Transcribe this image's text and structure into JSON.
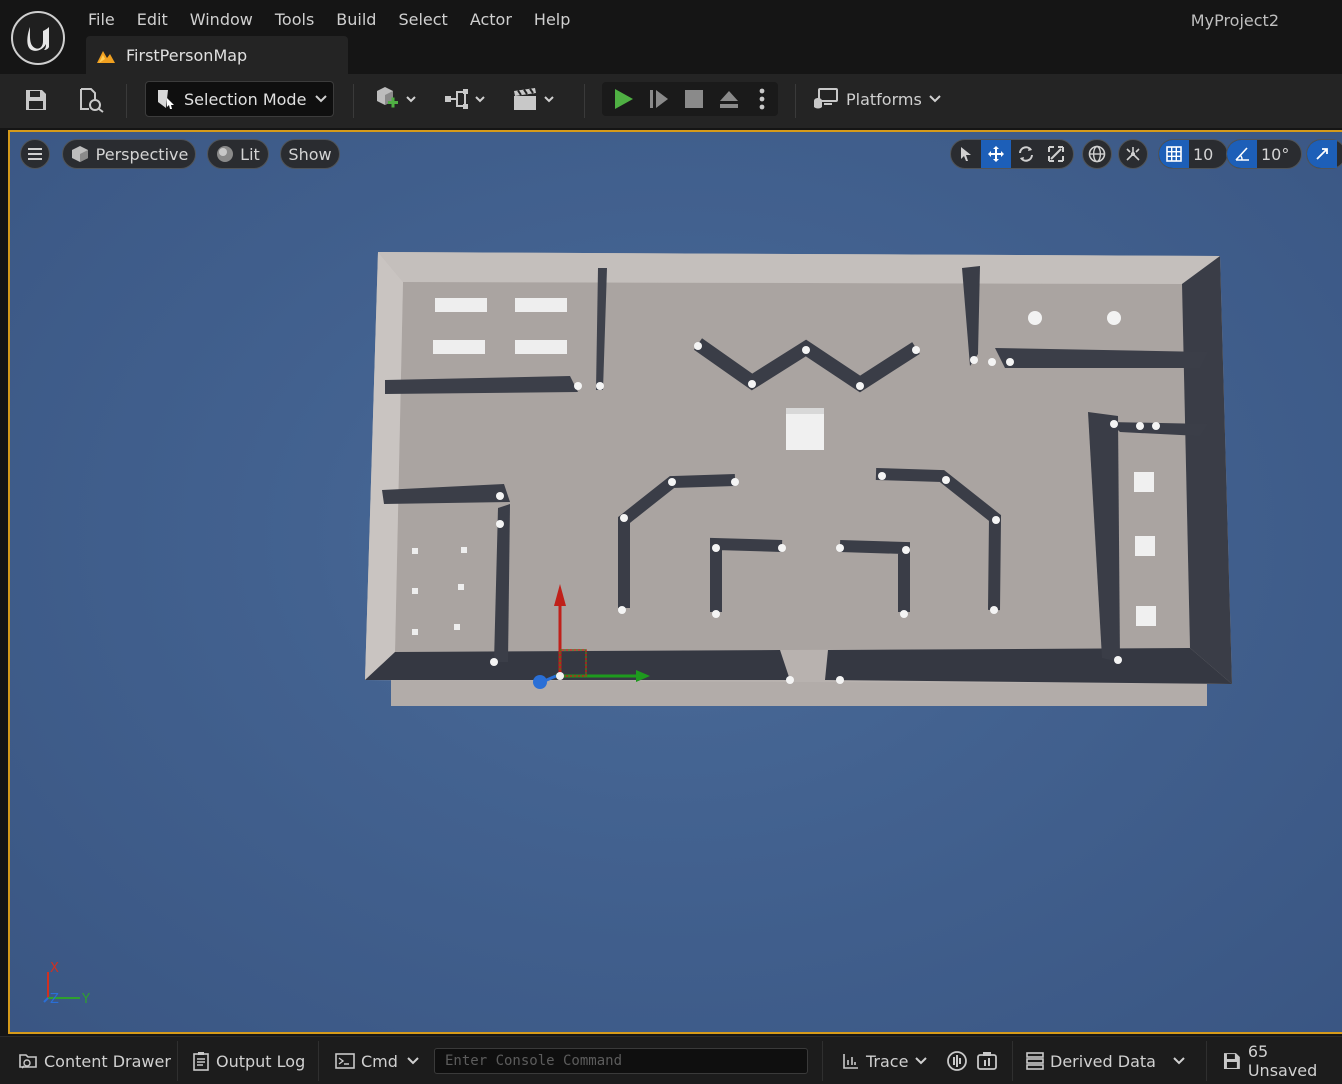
{
  "menu": {
    "items": [
      "File",
      "Edit",
      "Window",
      "Tools",
      "Build",
      "Select",
      "Actor",
      "Help"
    ],
    "project_name": "MyProject2"
  },
  "tab": {
    "map_name": "FirstPersonMap"
  },
  "toolbar": {
    "save_icon": "save-icon",
    "browse_icon": "browse-icon",
    "selection_mode_label": "Selection Mode",
    "platforms_label": "Platforms",
    "play_color": "#4fb043"
  },
  "viewport": {
    "perspective_label": "Perspective",
    "lit_label": "Lit",
    "show_label": "Show",
    "grid_snap_value": "10",
    "rotation_snap_value": "10°",
    "border_color": "#d59a1a",
    "background_color": "#42618f",
    "axis_labels": {
      "x": "X",
      "y": "Y",
      "z": "Z"
    }
  },
  "statusbar": {
    "content_drawer_label": "Content Drawer",
    "output_log_label": "Output Log",
    "cmd_label": "Cmd",
    "console_placeholder": "Enter Console Command",
    "trace_label": "Trace",
    "derived_data_label": "Derived Data",
    "unsaved_label": "65 Unsaved"
  }
}
